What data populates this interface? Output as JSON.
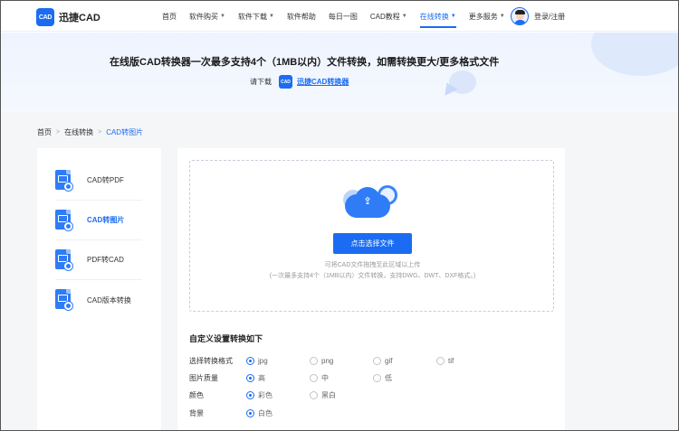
{
  "header": {
    "logo_mark": "CAD",
    "logo_text": "迅捷CAD",
    "nav": [
      {
        "label": "首页",
        "has_chevron": false
      },
      {
        "label": "软件购买",
        "has_chevron": true
      },
      {
        "label": "软件下载",
        "has_chevron": true
      },
      {
        "label": "软件帮助",
        "has_chevron": false
      },
      {
        "label": "每日一图",
        "has_chevron": false
      },
      {
        "label": "CAD教程",
        "has_chevron": true
      },
      {
        "label": "在线转换",
        "has_chevron": true,
        "active": true
      },
      {
        "label": "更多服务",
        "has_chevron": true
      }
    ],
    "login": "登录/注册"
  },
  "banner": {
    "title": "在线版CAD转换器一次最多支持4个（1MB以内）文件转换，如需转换更大/更多格式文件",
    "sub_prefix": "请下载",
    "mini_logo": "CAD",
    "link": "迅捷CAD转换器"
  },
  "breadcrumb": {
    "items": [
      "首页",
      "在线转换",
      "CAD转图片"
    ],
    "separator": ">"
  },
  "sidebar": {
    "items": [
      {
        "label": "CAD转PDF",
        "active": false
      },
      {
        "label": "CAD转图片",
        "active": true
      },
      {
        "label": "PDF转CAD",
        "active": false
      },
      {
        "label": "CAD版本转换",
        "active": false
      }
    ]
  },
  "upload": {
    "button": "点击选择文件",
    "hint1": "可将CAD文件拖拽至此区域以上传",
    "hint2": "(一次最多支持4个（1MB以内）文件转换，支持DWG、DWT、DXF格式。)"
  },
  "settings": {
    "title": "自定义设置转换如下",
    "rows": [
      {
        "label": "选择转换格式",
        "options": [
          {
            "label": "jpg",
            "selected": true
          },
          {
            "label": "png",
            "selected": false
          },
          {
            "label": "gif",
            "selected": false
          },
          {
            "label": "tif",
            "selected": false
          }
        ]
      },
      {
        "label": "图片质量",
        "options": [
          {
            "label": "高",
            "selected": true
          },
          {
            "label": "中",
            "selected": false
          },
          {
            "label": "低",
            "selected": false
          }
        ]
      },
      {
        "label": "颜色",
        "options": [
          {
            "label": "彩色",
            "selected": true
          },
          {
            "label": "黑白",
            "selected": false
          }
        ]
      },
      {
        "label": "背景",
        "options": [
          {
            "label": "白色",
            "selected": true
          }
        ]
      }
    ]
  },
  "colors": {
    "accent": "#1b6cf2",
    "page_bg": "#f5f6f8"
  },
  "icons": {
    "upload": "cloud-upload-icon",
    "file": "cad-file-icon",
    "avatar": "user-avatar-icon"
  }
}
